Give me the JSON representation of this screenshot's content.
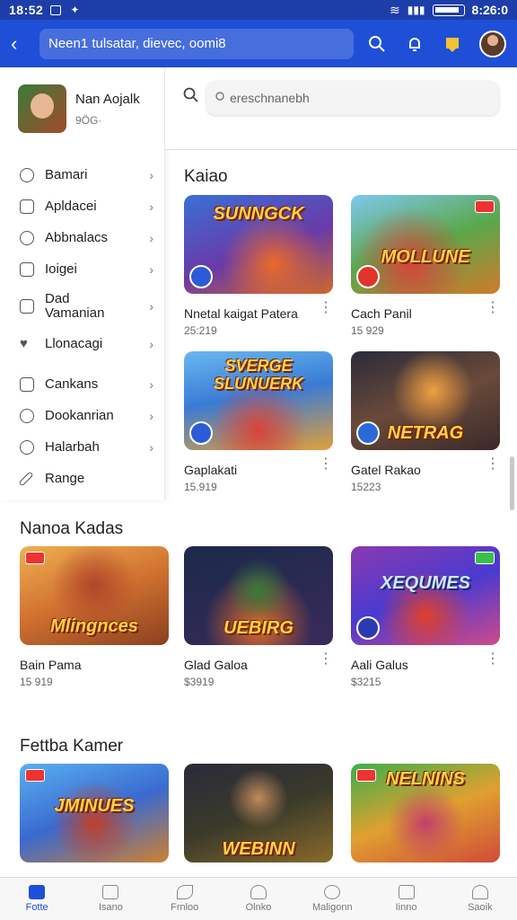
{
  "status_bar": {
    "time": "18:52",
    "clock_right": "8:26:0"
  },
  "app_bar": {
    "back_label": "‹",
    "url_text": "Neen1 tulsatar, dievec, oomi8"
  },
  "sidebar": {
    "profile_name": "Nan Aojalk",
    "profile_sub": "9ÖG·",
    "items": [
      {
        "label": "Bamari",
        "icon": "chat-icon"
      },
      {
        "label": "Apldacei",
        "icon": "bell-icon"
      },
      {
        "label": "Abbnalacs",
        "icon": "tag-icon"
      },
      {
        "label": "Ioigei",
        "icon": "box-icon"
      },
      {
        "label": "Dad\nVamanian",
        "icon": "square-icon"
      },
      {
        "label": "Llonacagi",
        "icon": "heart-icon"
      },
      {
        "label": "Cankans",
        "icon": "folder-icon"
      },
      {
        "label": "Dookanrian",
        "icon": "gear-icon"
      },
      {
        "label": "Halarbah",
        "icon": "clock-icon"
      },
      {
        "label": "Range",
        "icon": "pen-icon"
      }
    ]
  },
  "search": {
    "placeholder": "ereschnanebh"
  },
  "sections": {
    "first": "Kaiao",
    "second": "Nanoa Kadas",
    "third": "Fettba Kamer"
  },
  "cards_row1": [
    {
      "name": "Nnetal kaigat Patera",
      "value": "25:219",
      "art_title": "SUNNGCK"
    },
    {
      "name": "Cach Panil",
      "value": "15 929",
      "art_title": "MOLLUNE"
    }
  ],
  "cards_row2": [
    {
      "name": "Gaplakati",
      "value": "15.919",
      "art_title": "SVERGE\nSLUNUERK"
    },
    {
      "name": "Gatel Rakao",
      "value": "15223",
      "art_title": "NETRAG"
    }
  ],
  "cards_row3": [
    {
      "name": "Bain Pama",
      "value": "15 919",
      "art_title": "Mlingnces"
    },
    {
      "name": "Glad Galoa",
      "value": "$3919",
      "art_title": "UEBIRG"
    },
    {
      "name": "Aali Galus",
      "value": "$3215",
      "art_title": "XEQUMES"
    }
  ],
  "cards_row4": [
    {
      "art_title": "JMINUES"
    },
    {
      "art_title": "WEBINN"
    },
    {
      "art_title": "NELNINS"
    }
  ],
  "bottom_nav": [
    {
      "label": "Fotte",
      "icon": "home-icon"
    },
    {
      "label": "Isano",
      "icon": "calendar-icon"
    },
    {
      "label": "Frnloo",
      "icon": "leaf-icon"
    },
    {
      "label": "Olnko",
      "icon": "triangle-icon"
    },
    {
      "label": "Maligonn",
      "icon": "circle-icon"
    },
    {
      "label": "Iinno",
      "icon": "inbox-icon"
    },
    {
      "label": "Saoik",
      "icon": "person-icon"
    }
  ],
  "colors": {
    "primary": "#1f4fd6",
    "statusbar": "#1d3ea8"
  }
}
